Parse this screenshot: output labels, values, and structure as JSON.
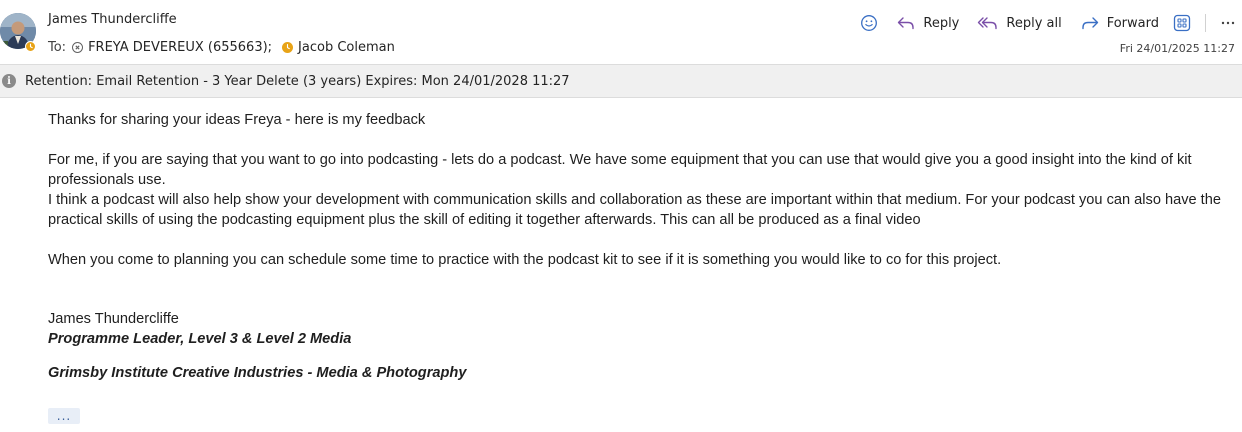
{
  "header": {
    "sender_name": "James Thundercliffe",
    "to_label": "To:",
    "recipients": [
      {
        "name": "FREYA DEVEREUX (655663);",
        "status": "blocked"
      },
      {
        "name": "Jacob Coleman",
        "status": "away"
      }
    ],
    "date": "Fri 24/01/2025 11:27"
  },
  "actions": {
    "reply_label": "Reply",
    "reply_all_label": "Reply all",
    "forward_label": "Forward"
  },
  "retention": {
    "text": "Retention: Email Retention - 3 Year Delete (3 years) Expires: Mon 24/01/2028 11:27"
  },
  "body": {
    "p1": "Thanks for sharing your ideas Freya - here is my feedback",
    "p2": "For me, if you are saying that you want to go into podcasting - lets do a podcast. We have some equipment that you can use that would give you a good insight into the kind of kit professionals use.",
    "p3": "I think a podcast will also help show your development with communication skills and collaboration as these are important within that medium. For your podcast you can also have the practical skills of using the podcasting equipment plus the skill of editing it together afterwards. This can all be produced as a final video",
    "p4": "When you come to planning you can schedule some time to practice with the podcast kit to see if it is something you would like to co for this project."
  },
  "signature": {
    "name": "James Thundercliffe",
    "role": "Programme Leader, Level 3 & Level 2 Media",
    "org": "Grimsby Institute Creative Industries - Media & Photography"
  },
  "more_label": "...",
  "colors": {
    "accent": "#3a6fc4",
    "away_status": "#e8a317",
    "retention_bg": "#f0f0f0"
  },
  "icons": [
    "emoji-icon",
    "reply-icon",
    "reply-all-icon",
    "forward-icon",
    "apps-icon",
    "more-options-icon",
    "info-icon",
    "blocked-icon",
    "away-status-icon"
  ]
}
